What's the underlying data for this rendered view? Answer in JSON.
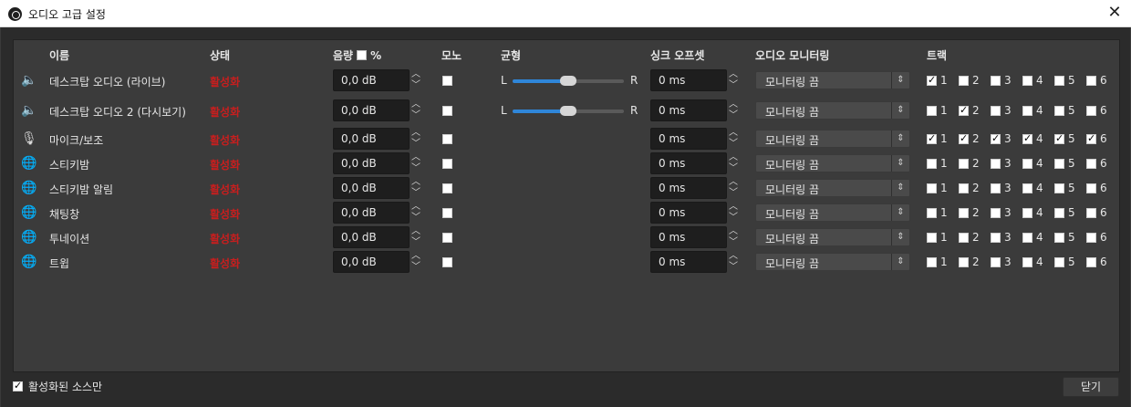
{
  "window": {
    "title": "오디오 고급 설정",
    "close_icon": "close-icon"
  },
  "headers": {
    "name": "이름",
    "status": "상태",
    "volume": "음량",
    "volume_percent": "%",
    "mono": "모노",
    "balance": "균형",
    "sync_offset": "싱크 오프셋",
    "audio_monitoring": "오디오 모니터링",
    "tracks": "트랙"
  },
  "balance_labels": {
    "left": "L",
    "right": "R"
  },
  "rows": [
    {
      "icon": "speaker-icon",
      "name": "데스크탑 오디오 (라이브)",
      "status": "활성화",
      "volume": "0,0 dB",
      "mono": false,
      "balance": 0.5,
      "offset": "0 ms",
      "monitoring": "모니터링 끔",
      "tracks": [
        true,
        false,
        false,
        false,
        false,
        false
      ]
    },
    {
      "icon": "speaker-icon",
      "name": "데스크탑 오디오 2 (다시보기)",
      "status": "활성화",
      "volume": "0,0 dB",
      "mono": false,
      "balance": 0.5,
      "offset": "0 ms",
      "monitoring": "모니터링 끔",
      "tracks": [
        false,
        true,
        false,
        false,
        false,
        false
      ]
    },
    {
      "icon": "microphone-icon",
      "name": "마이크/보조",
      "status": "활성화",
      "volume": "0,0 dB",
      "mono": false,
      "offset": "0 ms",
      "monitoring": "모니터링 끔",
      "tracks": [
        true,
        true,
        true,
        true,
        true,
        true
      ]
    },
    {
      "icon": "globe-icon",
      "name": "스티키밤",
      "status": "활성화",
      "volume": "0,0 dB",
      "mono": false,
      "offset": "0 ms",
      "monitoring": "모니터링 끔",
      "tracks": [
        false,
        false,
        false,
        false,
        false,
        false
      ]
    },
    {
      "icon": "globe-icon",
      "name": "스티키밤 알림",
      "status": "활성화",
      "volume": "0,0 dB",
      "mono": false,
      "offset": "0 ms",
      "monitoring": "모니터링 끔",
      "tracks": [
        false,
        false,
        false,
        false,
        false,
        false
      ]
    },
    {
      "icon": "globe-icon",
      "name": "채팅창",
      "status": "활성화",
      "volume": "0,0 dB",
      "mono": false,
      "offset": "0 ms",
      "monitoring": "모니터링 끔",
      "tracks": [
        false,
        false,
        false,
        false,
        false,
        false
      ]
    },
    {
      "icon": "globe-icon",
      "name": "투네이션",
      "status": "활성화",
      "volume": "0,0 dB",
      "mono": false,
      "offset": "0 ms",
      "monitoring": "모니터링 끔",
      "tracks": [
        false,
        false,
        false,
        false,
        false,
        false
      ]
    },
    {
      "icon": "globe-icon",
      "name": "트윕",
      "status": "활성화",
      "volume": "0,0 dB",
      "mono": false,
      "offset": "0 ms",
      "monitoring": "모니터링 끔",
      "tracks": [
        false,
        false,
        false,
        false,
        false,
        false
      ]
    }
  ],
  "track_numbers": [
    "1",
    "2",
    "3",
    "4",
    "5",
    "6"
  ],
  "footer": {
    "active_only_label": "활성화된 소스만",
    "active_only_checked": true,
    "close_label": "닫기"
  }
}
